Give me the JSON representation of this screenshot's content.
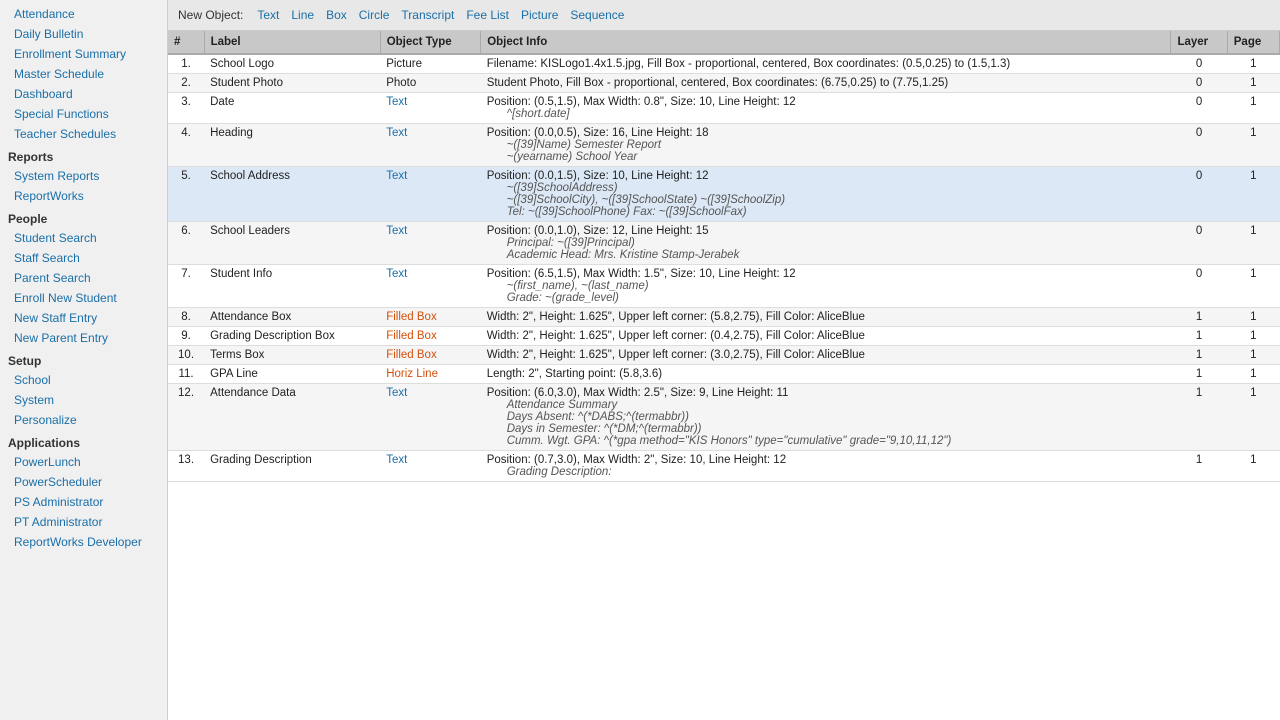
{
  "sidebar": {
    "sections": [
      {
        "header": null,
        "items": [
          {
            "label": "Attendance",
            "name": "attendance"
          },
          {
            "label": "Daily Bulletin",
            "name": "daily-bulletin"
          },
          {
            "label": "Enrollment Summary",
            "name": "enrollment-summary"
          },
          {
            "label": "Master Schedule",
            "name": "master-schedule"
          },
          {
            "label": "Dashboard",
            "name": "dashboard"
          },
          {
            "label": "Special Functions",
            "name": "special-functions"
          },
          {
            "label": "Teacher Schedules",
            "name": "teacher-schedules"
          }
        ]
      },
      {
        "header": "Reports",
        "items": [
          {
            "label": "System Reports",
            "name": "system-reports"
          },
          {
            "label": "ReportWorks",
            "name": "reportworks"
          }
        ]
      },
      {
        "header": "People",
        "items": [
          {
            "label": "Student Search",
            "name": "student-search"
          },
          {
            "label": "Staff Search",
            "name": "staff-search"
          },
          {
            "label": "Parent Search",
            "name": "parent-search"
          },
          {
            "label": "Enroll New Student",
            "name": "enroll-new-student"
          },
          {
            "label": "New Staff Entry",
            "name": "new-staff-entry"
          },
          {
            "label": "New Parent Entry",
            "name": "new-parent-entry"
          }
        ]
      },
      {
        "header": "Setup",
        "items": [
          {
            "label": "School",
            "name": "school"
          },
          {
            "label": "System",
            "name": "system"
          },
          {
            "label": "Personalize",
            "name": "personalize"
          }
        ]
      },
      {
        "header": "Applications",
        "items": [
          {
            "label": "PowerLunch",
            "name": "powerlunch"
          },
          {
            "label": "PowerScheduler",
            "name": "powerscheduler"
          },
          {
            "label": "PS Administrator",
            "name": "ps-administrator"
          },
          {
            "label": "PT Administrator",
            "name": "pt-administrator"
          },
          {
            "label": "ReportWorks Developer",
            "name": "reportworks-developer"
          }
        ]
      }
    ]
  },
  "toolbar": {
    "new_object_label": "New Object:",
    "links": [
      "Text",
      "Line",
      "Box",
      "Circle",
      "Transcript",
      "Fee List",
      "Picture",
      "Sequence"
    ]
  },
  "table": {
    "columns": [
      "#",
      "Label",
      "Object Type",
      "Object Info",
      "Layer",
      "Page"
    ],
    "rows": [
      {
        "num": "1.",
        "label": "School Logo",
        "type": "Picture",
        "info": "Filename: KISLogo1.4x1.5.jpg, Fill Box - proportional, centered, Box coordinates: (0.5,0.25) to (1.5,1.3)",
        "sub_lines": [],
        "layer": "0",
        "page": "1",
        "highlighted": false
      },
      {
        "num": "2.",
        "label": "Student Photo",
        "type": "Photo",
        "info": "Student Photo, Fill Box - proportional, centered, Box coordinates: (6.75,0.25) to (7.75,1.25)",
        "sub_lines": [],
        "layer": "0",
        "page": "1",
        "highlighted": false
      },
      {
        "num": "3.",
        "label": "Date",
        "type": "Text",
        "info": "Position: (0.5,1.5), Max Width: 0.8\", Size: 10, Line Height: 12",
        "sub_lines": [
          "^[short.date]"
        ],
        "layer": "0",
        "page": "1",
        "highlighted": false
      },
      {
        "num": "4.",
        "label": "Heading",
        "type": "Text",
        "info": "Position: (0.0,0.5), Size: 16, Line Height: 18",
        "sub_lines": [
          "~([39]Name) Semester Report",
          "~(yearname) School Year"
        ],
        "layer": "0",
        "page": "1",
        "highlighted": false
      },
      {
        "num": "5.",
        "label": "School Address",
        "type": "Text",
        "info": "Position: (0.0,1.5), Size: 10, Line Height: 12",
        "sub_lines": [
          "~([39]SchoolAddress)",
          "~([39]SchoolCity), ~([39]SchoolState) ~([39]SchoolZip)",
          "Tel: ~([39]SchoolPhone) Fax: ~([39]SchoolFax)"
        ],
        "layer": "0",
        "page": "1",
        "highlighted": true
      },
      {
        "num": "6.",
        "label": "School Leaders",
        "type": "Text",
        "info": "Position: (0.0,1.0), Size: 12, Line Height: 15",
        "sub_lines": [
          "Principal: ~([39]Principal)",
          "Academic Head: Mrs. Kristine Stamp-Jerabek"
        ],
        "layer": "0",
        "page": "1",
        "highlighted": false
      },
      {
        "num": "7.",
        "label": "Student Info",
        "type": "Text",
        "info": "Position: (6.5,1.5), Max Width: 1.5\", Size: 10, Line Height: 12",
        "sub_lines": [
          "~(first_name), ~(last_name)",
          "Grade: ~(grade_level)"
        ],
        "layer": "0",
        "page": "1",
        "highlighted": false
      },
      {
        "num": "8.",
        "label": "Attendance Box",
        "type": "Filled Box",
        "info": "Width: 2\", Height: 1.625\", Upper left corner: (5.8,2.75), Fill Color: AliceBlue",
        "sub_lines": [],
        "layer": "1",
        "page": "1",
        "highlighted": false
      },
      {
        "num": "9.",
        "label": "Grading Description Box",
        "type": "Filled Box",
        "info": "Width: 2\", Height: 1.625\", Upper left corner: (0.4,2.75), Fill Color: AliceBlue",
        "sub_lines": [],
        "layer": "1",
        "page": "1",
        "highlighted": false
      },
      {
        "num": "10.",
        "label": "Terms Box",
        "type": "Filled Box",
        "info": "Width: 2\", Height: 1.625\", Upper left corner: (3.0,2.75), Fill Color: AliceBlue",
        "sub_lines": [],
        "layer": "1",
        "page": "1",
        "highlighted": false
      },
      {
        "num": "11.",
        "label": "GPA Line",
        "type": "Horiz Line",
        "info": "Length: 2\", Starting point: (5.8,3.6)",
        "sub_lines": [],
        "layer": "1",
        "page": "1",
        "highlighted": false
      },
      {
        "num": "12.",
        "label": "Attendance Data",
        "type": "Text",
        "info": "Position: (6.0,3.0), Max Width: 2.5\", Size: 9, Line Height: 11",
        "sub_lines": [
          "Attendance Summary",
          "Days Absent: ^(*DABS;^(termabbr))",
          "Days in Semester: ^(*DM;^(termabbr))",
          "",
          "",
          "Cumm. Wgt. GPA: ^(*gpa method=\"KIS Honors\" type=\"cumulative\" grade=\"9,10,11,12\")"
        ],
        "layer": "1",
        "page": "1",
        "highlighted": false
      },
      {
        "num": "13.",
        "label": "Grading Description",
        "type": "Text",
        "info": "Position: (0.7,3.0), Max Width: 2\", Size: 10, Line Height: 12",
        "sub_lines": [
          "Grading Description:"
        ],
        "layer": "1",
        "page": "1",
        "highlighted": false
      }
    ]
  }
}
